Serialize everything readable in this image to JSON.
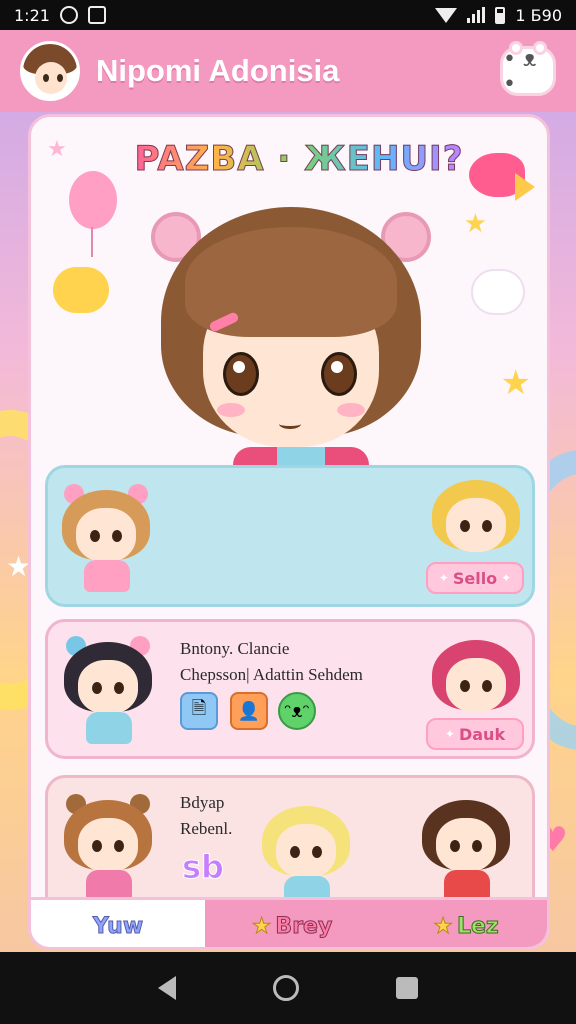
{
  "status_bar": {
    "time": "1:21",
    "right_text": "1 Б90"
  },
  "header": {
    "title": "Nipomi Adonisia"
  },
  "banner": {
    "title": "PAZBA · ЖEHUI?"
  },
  "rows": [
    {
      "button_label": "Sello"
    },
    {
      "line1": "Bntony. Clancie",
      "line2": "Chepsson| Adattin Sehdem",
      "button_label": "Dauk"
    },
    {
      "line1": "Bdyap",
      "line2": "Rebenl.",
      "sticker": "sb"
    }
  ],
  "tabs": [
    {
      "label": "Yuw"
    },
    {
      "label": "Brey"
    },
    {
      "label": "Lez"
    }
  ],
  "colors": {
    "header_pink": "#f49ac1",
    "card_bg": "#fdf6fb",
    "row1_bg": "#bfe6ef",
    "row2_bg": "#fde2ee",
    "accent_pink": "#d94f86"
  },
  "icons": [
    "signal-icon",
    "wifi-icon",
    "battery-icon",
    "mascot-icon",
    "back-icon",
    "home-icon",
    "recents-icon"
  ]
}
